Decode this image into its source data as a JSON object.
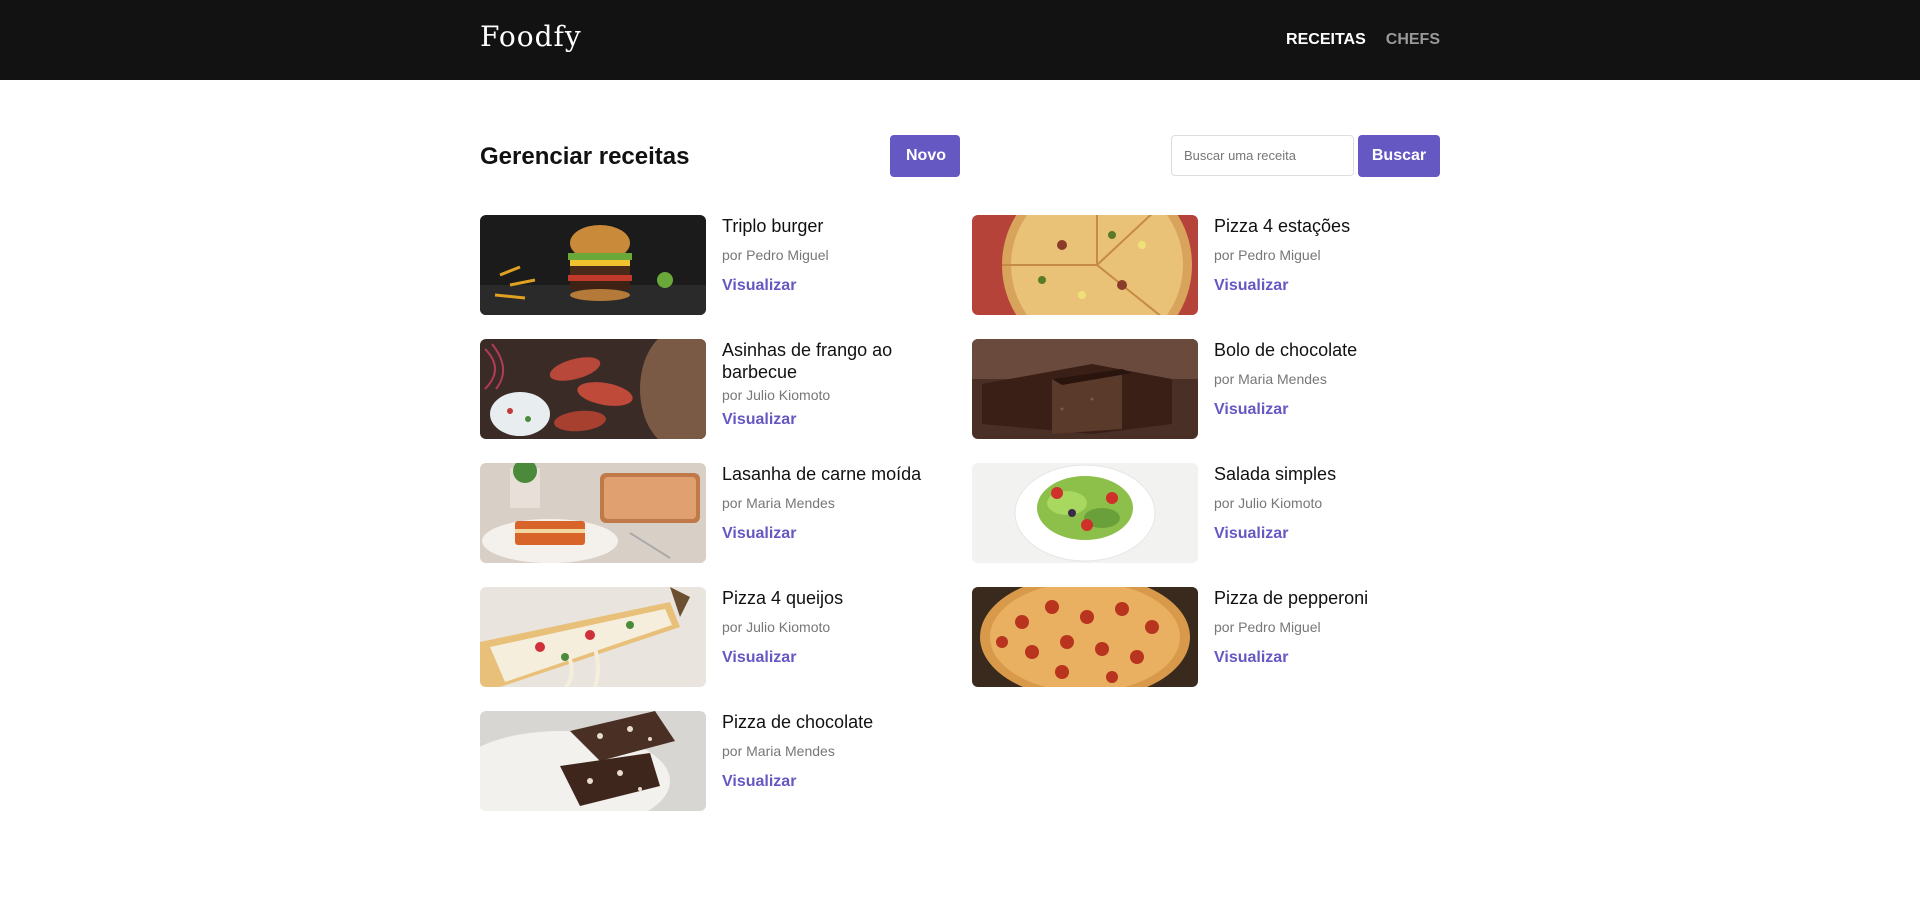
{
  "header": {
    "logo": "Foodfy",
    "nav": [
      {
        "label": "RECEITAS",
        "active": true
      },
      {
        "label": "CHEFS",
        "active": false
      }
    ]
  },
  "page": {
    "title": "Gerenciar receitas",
    "new_button": "Novo",
    "search_placeholder": "Buscar uma receita",
    "search_button": "Buscar"
  },
  "recipes": [
    {
      "name": "Triplo burger",
      "author": "por Pedro Miguel",
      "link": "Visualizar",
      "image": "burger"
    },
    {
      "name": "Pizza 4 estações",
      "author": "por Pedro Miguel",
      "link": "Visualizar",
      "image": "pizza-4-estacoes"
    },
    {
      "name": "Asinhas de frango ao barbecue",
      "author": "por Julio Kiomoto",
      "link": "Visualizar",
      "image": "chicken-wings"
    },
    {
      "name": "Bolo de chocolate",
      "author": "por Maria Mendes",
      "link": "Visualizar",
      "image": "chocolate-cake"
    },
    {
      "name": "Lasanha de carne moída",
      "author": "por Maria Mendes",
      "link": "Visualizar",
      "image": "lasagna"
    },
    {
      "name": "Salada simples",
      "author": "por Julio Kiomoto",
      "link": "Visualizar",
      "image": "salad"
    },
    {
      "name": "Pizza 4 queijos",
      "author": "por Julio Kiomoto",
      "link": "Visualizar",
      "image": "cheese-pizza"
    },
    {
      "name": "Pizza de pepperoni",
      "author": "por Pedro Miguel",
      "link": "Visualizar",
      "image": "pepperoni-pizza"
    },
    {
      "name": "Pizza de chocolate",
      "author": "por Maria Mendes",
      "link": "Visualizar",
      "image": "chocolate-pizza"
    }
  ],
  "colors": {
    "accent": "#6558c3",
    "topbar": "#121212"
  }
}
